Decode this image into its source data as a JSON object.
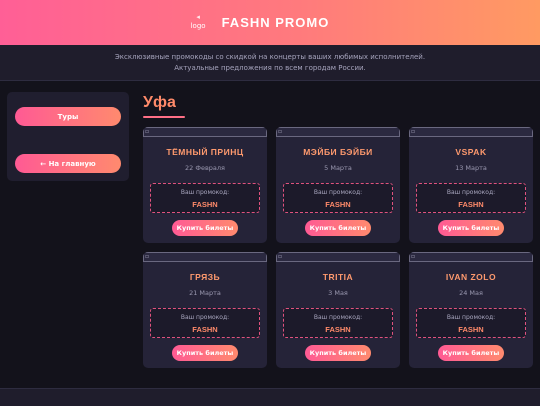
{
  "header": {
    "logo_glyph": "◂",
    "logo_alt": "logo",
    "brand": "FASHN PROMO"
  },
  "intro": {
    "line1": "Эксклюзивные промокоды со скидкой на концерты ваших любимых исполнителей.",
    "line2": "Актуальные предложения по всем городам России."
  },
  "sidebar": {
    "tours_label": "Туры",
    "home_label": "← На главную"
  },
  "city": {
    "title": "Уфа"
  },
  "cards": [
    {
      "artist": "ТЁМНЫЙ ПРИНЦ",
      "date": "22 Февраля",
      "promo_label": "Ваш промокод:",
      "promo_code": "FASHN",
      "button": "Купить билеты"
    },
    {
      "artist": "МЭЙБИ БЭЙБИ",
      "date": "5 Марта",
      "promo_label": "Ваш промокод:",
      "promo_code": "FASHN",
      "button": "Купить билеты"
    },
    {
      "artist": "VSPAK",
      "date": "13 Марта",
      "promo_label": "Ваш промокод:",
      "promo_code": "FASHN",
      "button": "Купить билеты"
    },
    {
      "artist": "ГРЯЗЬ",
      "date": "21 Марта",
      "promo_label": "Ваш промокод:",
      "promo_code": "FASHN",
      "button": "Купить билеты"
    },
    {
      "artist": "TRITIA",
      "date": "3 Мая",
      "promo_label": "Ваш промокод:",
      "promo_code": "FASHN",
      "button": "Купить билеты"
    },
    {
      "artist": "IVAN ZOLO",
      "date": "24 Мая",
      "promo_label": "Ваш промокод:",
      "promo_code": "FASHN",
      "button": "Купить билеты"
    }
  ],
  "colors": {
    "accent_start": "#ff5a94",
    "accent_end": "#ff8a6e",
    "background": "#13121b"
  }
}
